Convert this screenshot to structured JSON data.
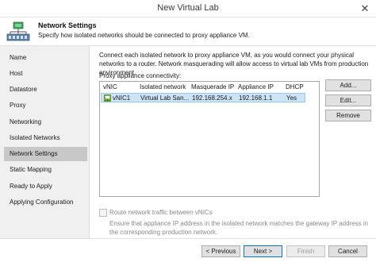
{
  "window": {
    "title": "New Virtual Lab",
    "close_glyph": "✕"
  },
  "header": {
    "title": "Network Settings",
    "subtitle": "Specify how isolated networks should be connected to proxy appliance VM."
  },
  "nav": {
    "items": [
      {
        "label": "Name"
      },
      {
        "label": "Host"
      },
      {
        "label": "Datastore"
      },
      {
        "label": "Proxy"
      },
      {
        "label": "Networking"
      },
      {
        "label": "Isolated Networks"
      },
      {
        "label": "Network Settings"
      },
      {
        "label": "Static Mapping"
      },
      {
        "label": "Ready to Apply"
      },
      {
        "label": "Applying Configuration"
      }
    ],
    "active": "Network Settings"
  },
  "content": {
    "description": "Connect each isolated network to proxy appliance VM, as you would connect your physical networks to a router. Network masquerading will allow access to virtual lab VMs from production environment.",
    "connectivity_label": "Proxy appliance connectivity:",
    "table": {
      "columns": [
        "vNIC",
        "Isolated network",
        "Masquerade IP",
        "Appliance IP",
        "DHCP"
      ],
      "rows": [
        {
          "vnic": "vNIC1",
          "network": "Virtual Lab San...",
          "masquerade": "192.168.254.x",
          "appliance": "192.168.1.1",
          "dhcp": "Yes",
          "selected": true
        }
      ]
    },
    "buttons": {
      "add": "Add...",
      "edit": "Edit...",
      "remove": "Remove"
    },
    "route_checkbox": {
      "label": "Route network traffic between vNICs",
      "checked": false,
      "enabled": false
    },
    "route_note": "Ensure that appliance IP address in the isolated network matches the gateway IP address in the corresponding production network."
  },
  "footer": {
    "previous": "< Previous",
    "next": "Next >",
    "finish": "Finish",
    "cancel": "Cancel"
  },
  "colors": {
    "selection": "#cce4f7",
    "nav_active": "#c8c8c8",
    "primary_border": "#0078d7"
  },
  "icons": {
    "header_logo": "virtual-lab-icon",
    "row_icon": "vnic-icon",
    "close": "close-icon"
  }
}
